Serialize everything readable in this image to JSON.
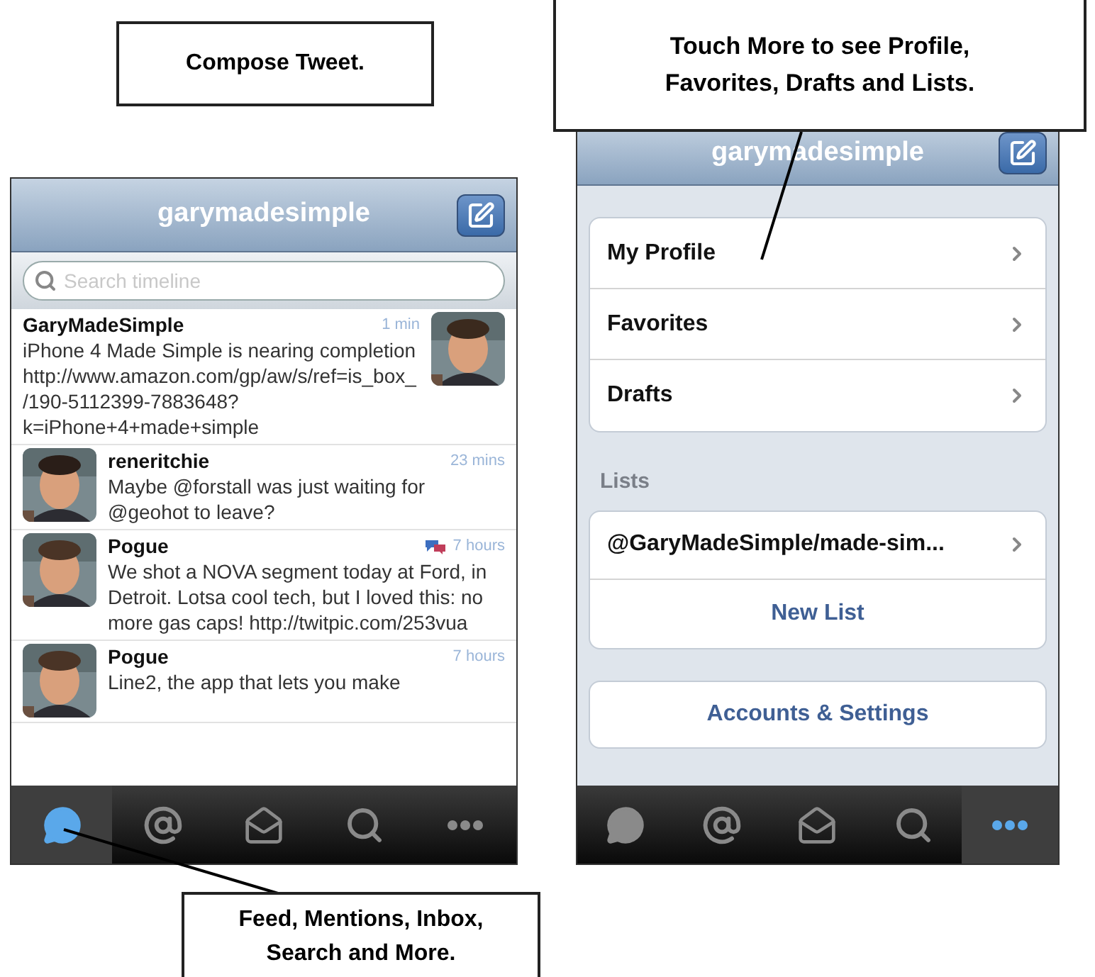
{
  "callouts": [
    {
      "text": "Compose Tweet."
    },
    {
      "text": "Touch More to see Profile,\nFavorites, Drafts and Lists."
    },
    {
      "text": "Feed, Mentions, Inbox,\nSearch and More."
    }
  ],
  "timeline_screen": {
    "title": "garymadesimple",
    "search": {
      "placeholder": "Search timeline"
    },
    "tweets": [
      {
        "name": "GaryMadeSimple",
        "time": "1 min",
        "text": "iPhone 4 Made Simple is nearing completion http://www.amazon.com/gp/aw/s/ref=is_box_/190-5112399-7883648?k=iPhone+4+made+simple",
        "kind": "avatar_right",
        "conversation": false
      },
      {
        "name": "reneritchie",
        "time": "23 mins",
        "text": "Maybe @forstall was just waiting for @geohot to leave?",
        "kind": "avatar_left",
        "conversation": false
      },
      {
        "name": "Pogue",
        "time": "7 hours",
        "text": "We shot a NOVA segment today at Ford, in Detroit. Lotsa cool tech, but I loved this: no more gas caps! http://twitpic.com/253vua",
        "kind": "avatar_left",
        "conversation": true
      },
      {
        "name": "Pogue",
        "time": "7 hours",
        "text": "Line2, the app that lets you make",
        "kind": "avatar_left",
        "conversation": false
      }
    ],
    "tabs": [
      {
        "kind": "feed",
        "selected": true
      },
      {
        "kind": "mentions",
        "selected": false
      },
      {
        "kind": "inbox",
        "selected": false
      },
      {
        "kind": "search",
        "selected": false
      },
      {
        "kind": "more",
        "selected": false
      }
    ]
  },
  "more_screen": {
    "title": "garymadesimple",
    "menu_items": [
      {
        "label": "My Profile"
      },
      {
        "label": "Favorites"
      },
      {
        "label": "Drafts"
      }
    ],
    "section_label": "Lists",
    "lists": [
      {
        "label": "@GaryMadeSimple/made-sim..."
      }
    ],
    "new_list": "New List",
    "accounts_button": "Accounts & Settings",
    "tabs": [
      {
        "kind": "feed",
        "selected": false
      },
      {
        "kind": "mentions",
        "selected": false
      },
      {
        "kind": "inbox",
        "selected": false
      },
      {
        "kind": "search",
        "selected": false
      },
      {
        "kind": "more",
        "selected": true
      }
    ]
  }
}
